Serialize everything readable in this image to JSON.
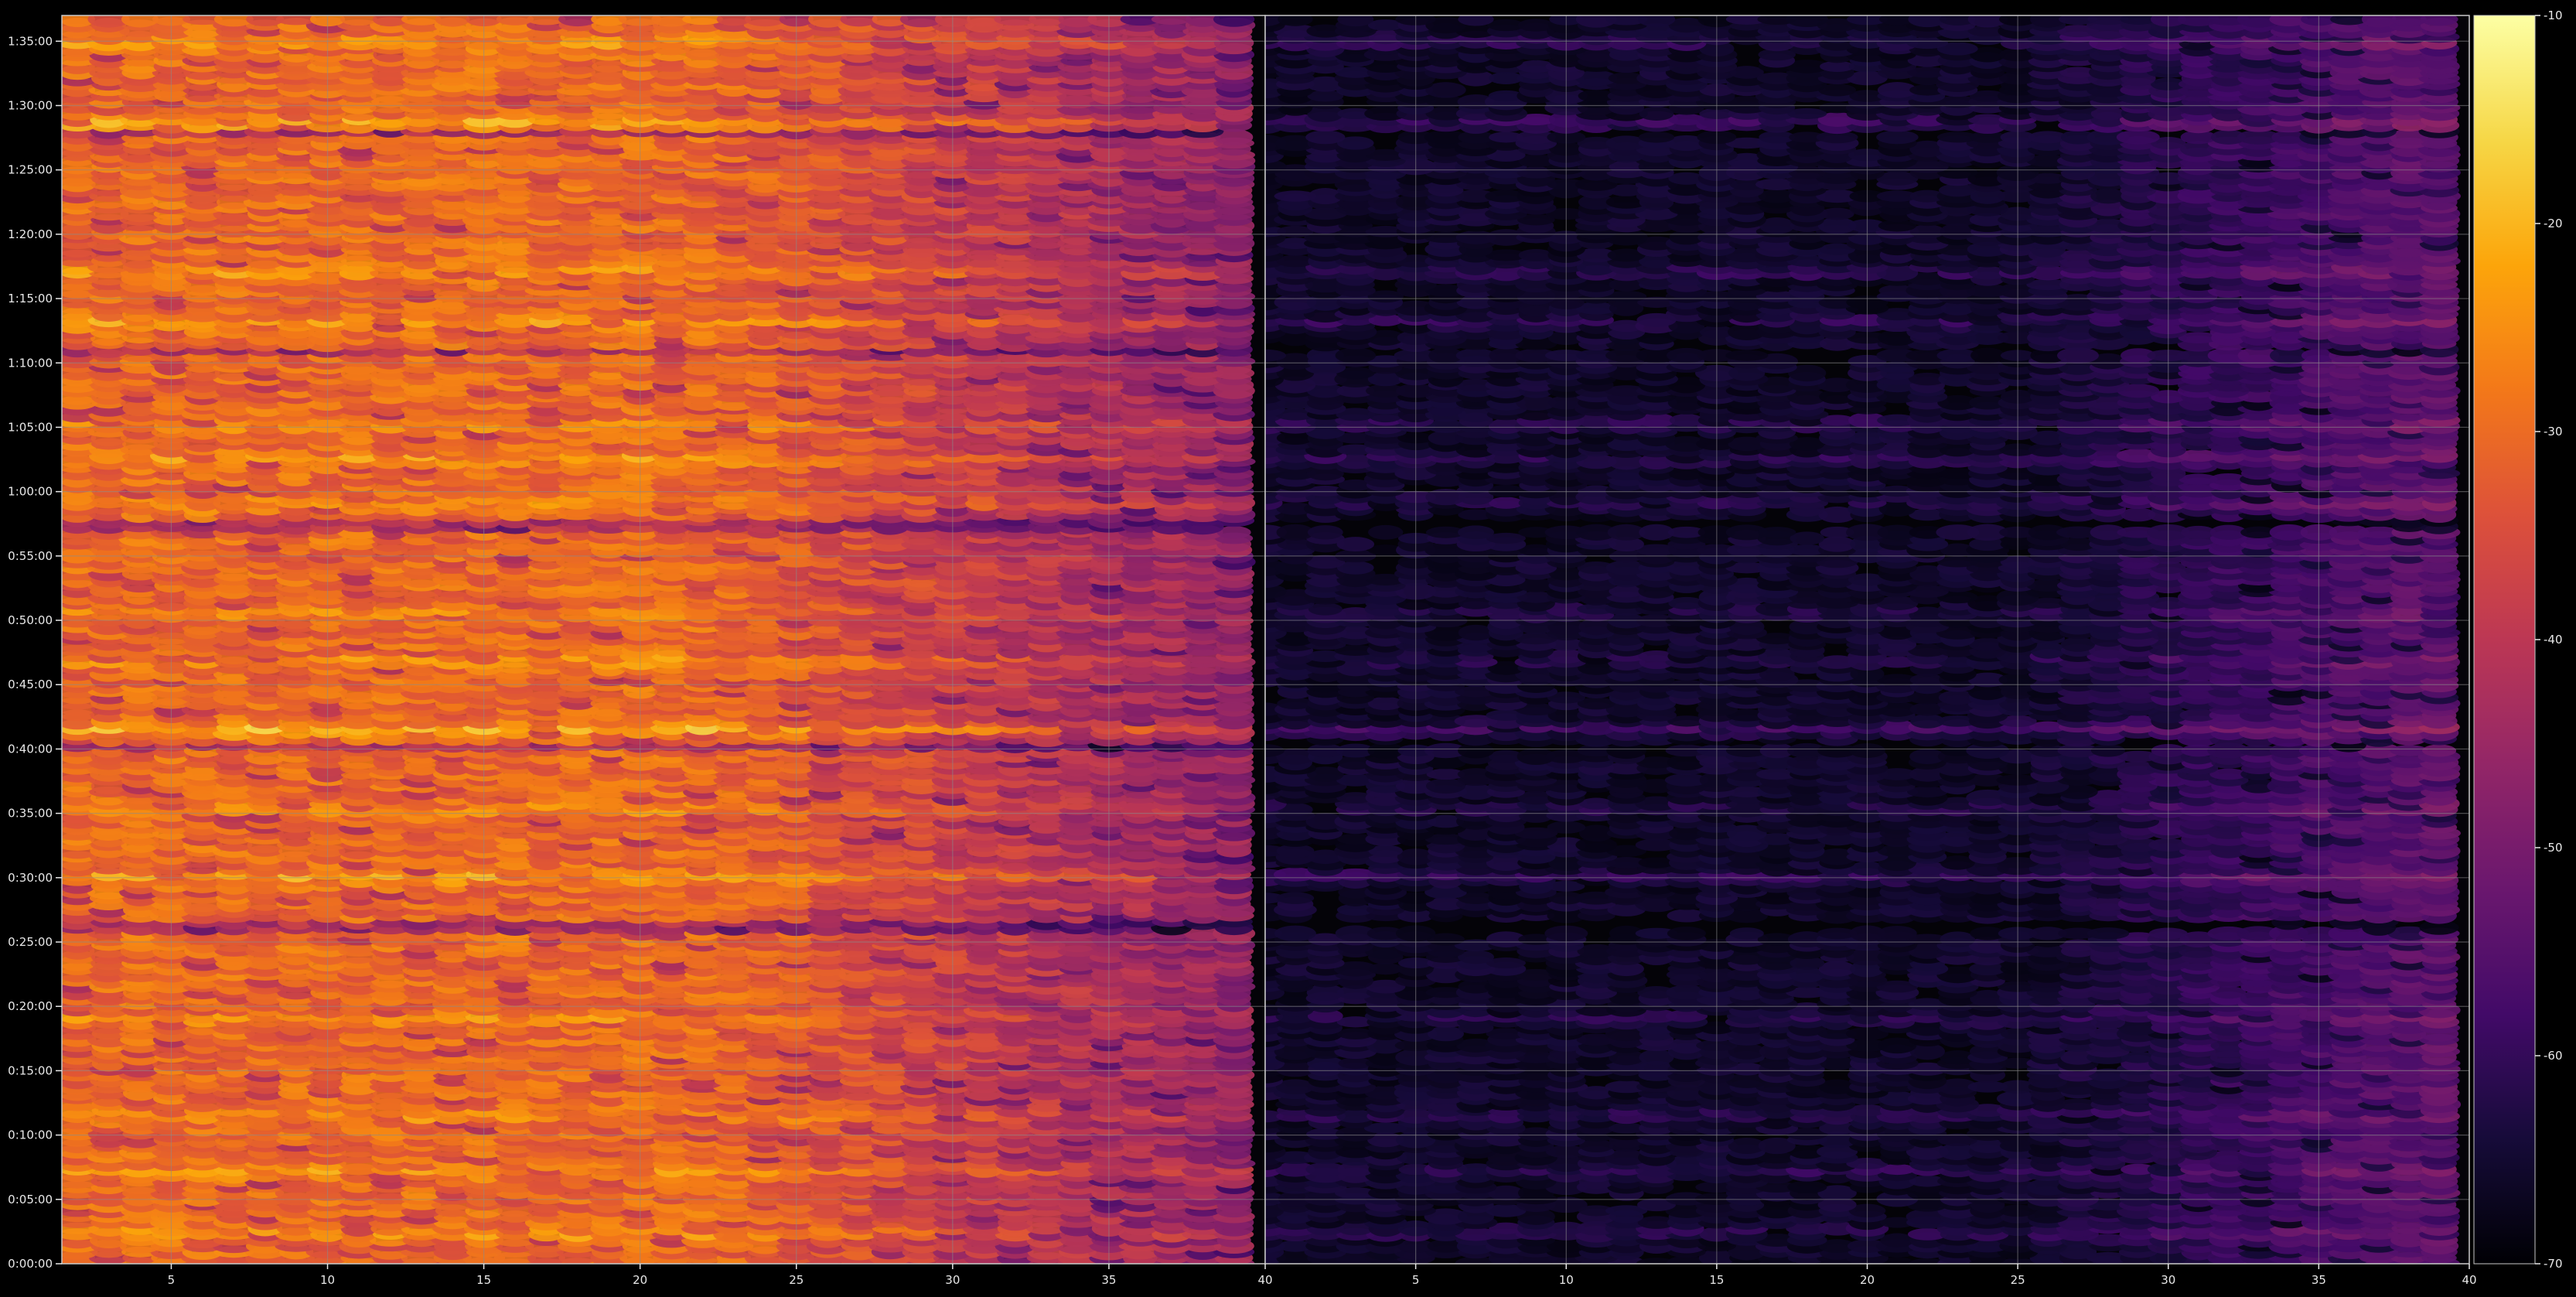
{
  "chart_data": {
    "type": "heatmap",
    "colormap": "inferno",
    "background_color": "#000000",
    "text_color": "#e8e8e8",
    "grid": true,
    "grid_color": "#8a8a8a",
    "colorbar": {
      "position": "right",
      "range": [
        -70,
        -10
      ],
      "ticks": [
        "-10",
        "-20",
        "-30",
        "-40",
        "-50",
        "-60",
        "-70"
      ],
      "tick_values": [
        -10,
        -20,
        -30,
        -40,
        -50,
        -60,
        -70
      ]
    },
    "panels": [
      {
        "name": "left",
        "x_range": [
          1.5,
          40
        ],
        "x_ticks": [
          "5",
          "10",
          "15",
          "20",
          "25",
          "30",
          "35",
          "40"
        ],
        "x_tick_values": [
          5,
          10,
          15,
          20,
          25,
          30,
          35,
          40
        ],
        "data_x_end": 39.5,
        "level_offset": 0,
        "falloff_start": 22,
        "falloff_per_unit": 0.95
      },
      {
        "name": "right",
        "x_range": [
          0,
          40
        ],
        "x_ticks": [
          "5",
          "10",
          "15",
          "20",
          "25",
          "30",
          "35",
          "40"
        ],
        "x_tick_values": [
          5,
          10,
          15,
          20,
          25,
          30,
          35,
          40
        ],
        "data_x_end": 39.5,
        "level_offset": -22,
        "falloff_start": 40,
        "falloff_per_unit": -0.9
      }
    ],
    "y_axis": {
      "range_seconds": [
        0,
        5820
      ],
      "ticks": [
        "0:00:00",
        "0:05:00",
        "0:10:00",
        "0:15:00",
        "0:20:00",
        "0:25:00",
        "0:30:00",
        "0:35:00",
        "0:40:00",
        "0:45:00",
        "0:50:00",
        "0:55:00",
        "1:00:00",
        "1:05:00",
        "1:10:00",
        "1:15:00",
        "1:20:00",
        "1:25:00",
        "1:30:00",
        "1:35:00"
      ],
      "tick_seconds": [
        0,
        300,
        600,
        900,
        1200,
        1500,
        1800,
        2100,
        2400,
        2700,
        3000,
        3300,
        3600,
        3900,
        4200,
        4500,
        4800,
        5100,
        5400,
        5700
      ]
    },
    "row_step_seconds": 55,
    "col_step": 1,
    "strong_bands_seconds": [
      {
        "t": 5325,
        "level": -14
      },
      {
        "t": 4630,
        "level": -18
      },
      {
        "t": 4400,
        "level": -20
      },
      {
        "t": 3920,
        "level": -18
      },
      {
        "t": 3760,
        "level": -19
      },
      {
        "t": 3550,
        "level": -20
      },
      {
        "t": 3040,
        "level": -22
      },
      {
        "t": 2820,
        "level": -20
      },
      {
        "t": 2500,
        "level": -13
      },
      {
        "t": 2130,
        "level": -21
      },
      {
        "t": 1810,
        "level": -17
      },
      {
        "t": 1150,
        "level": -22
      },
      {
        "t": 700,
        "level": -20
      },
      {
        "t": 440,
        "level": -21
      },
      {
        "t": 150,
        "level": -19
      },
      {
        "t": 5700,
        "level": -19
      }
    ],
    "dark_gaps_seconds": [
      {
        "from": 3420,
        "to": 3470
      },
      {
        "from": 2400,
        "to": 2440
      },
      {
        "from": 5270,
        "to": 5290
      },
      {
        "from": 4250,
        "to": 4280
      },
      {
        "from": 1560,
        "to": 1610
      }
    ]
  }
}
